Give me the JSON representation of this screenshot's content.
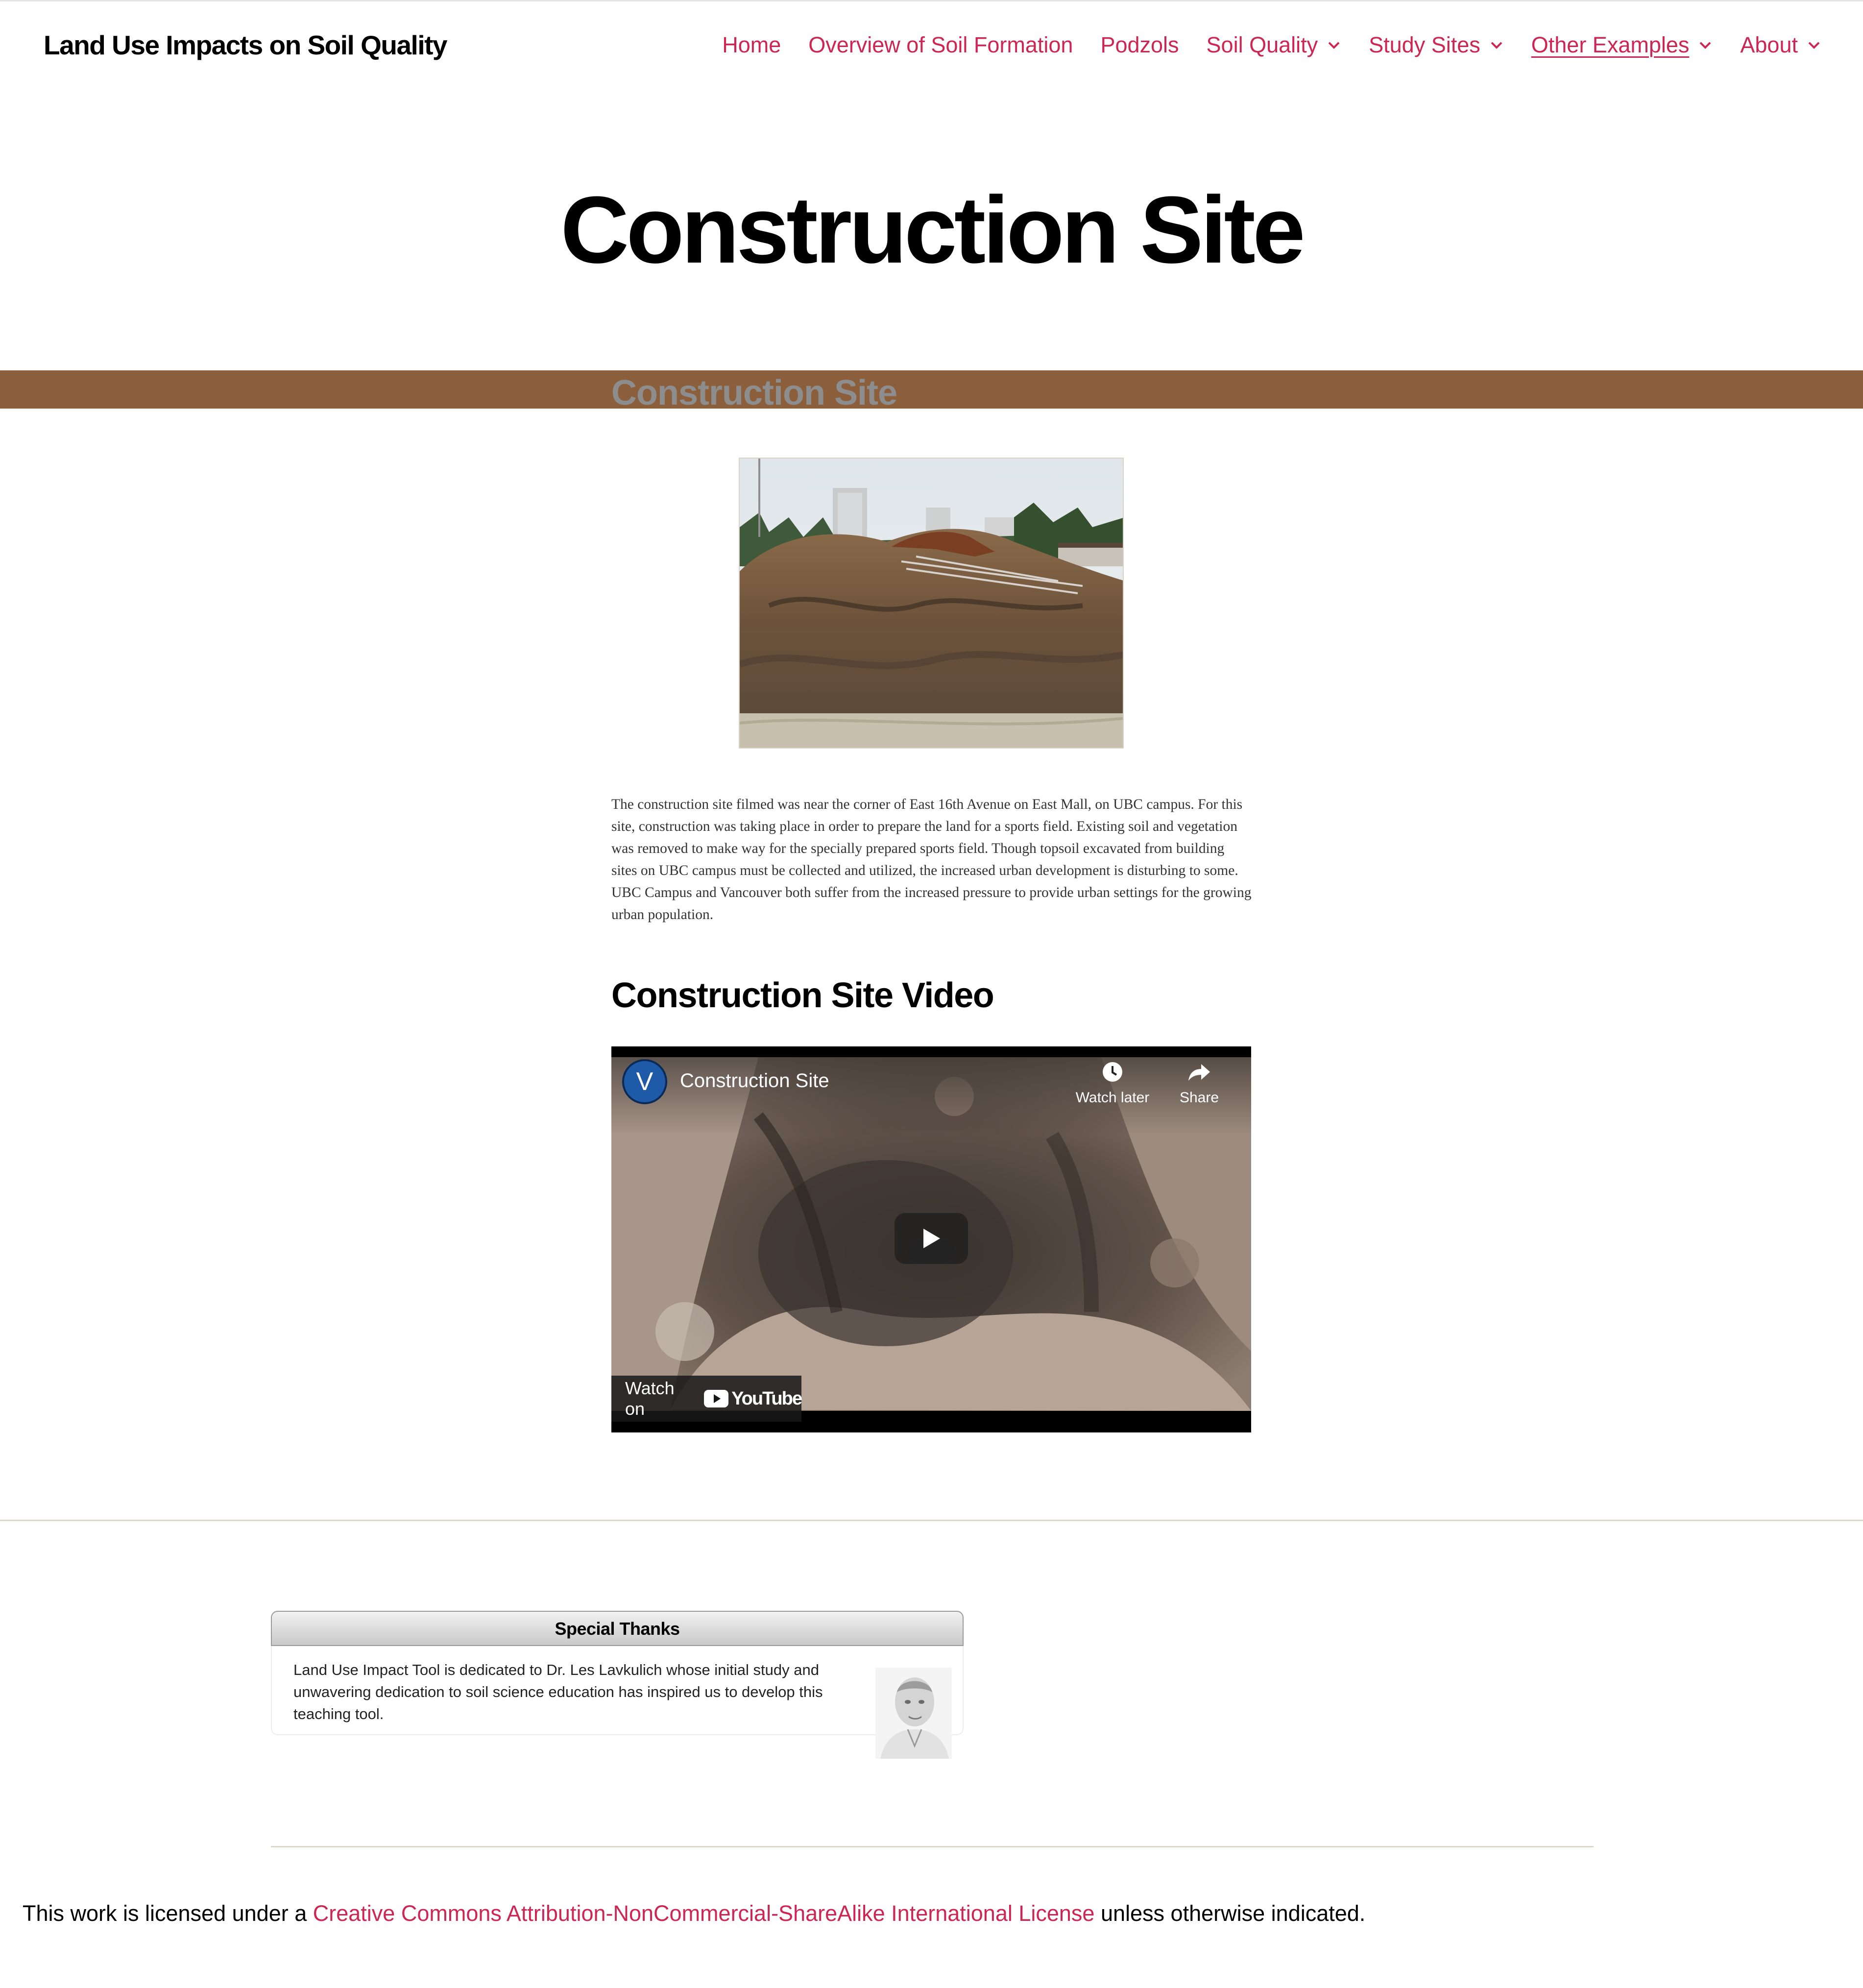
{
  "header": {
    "site_title": "Land Use Impacts on Soil Quality",
    "nav": [
      {
        "label": "Home",
        "has_submenu": false
      },
      {
        "label": "Overview of Soil Formation",
        "has_submenu": false
      },
      {
        "label": "Podzols",
        "has_submenu": false
      },
      {
        "label": "Soil Quality",
        "has_submenu": true
      },
      {
        "label": "Study Sites",
        "has_submenu": true
      },
      {
        "label": "Other Examples",
        "has_submenu": true,
        "current": true
      },
      {
        "label": "About",
        "has_submenu": true
      }
    ]
  },
  "page": {
    "title": "Construction Site",
    "band_title": "Construction Site",
    "body_paragraph": "The construction site filmed was near the corner of East 16th Avenue on East Mall, on UBC campus.  For this site, construction was taking place in order to prepare the land for a sports field.  Existing soil and vegetation was removed to make way for the specially prepared sports field.  Though topsoil excavated from building sites on UBC campus must be collected and utilized, the increased urban development is disturbing to some.  UBC Campus and Vancouver both suffer from the increased pressure to provide urban settings for the growing urban population.",
    "video_heading": "Construction Site Video"
  },
  "video": {
    "channel_initial": "V",
    "title": "Construction Site",
    "watch_later": "Watch later",
    "share": "Share",
    "watch_on": "Watch on",
    "youtube": "YouTube"
  },
  "footer": {
    "thanks_title": "Special Thanks",
    "thanks_text": "Land Use Impact Tool is dedicated to Dr. Les Lavkulich whose initial study and unwavering dedication to soil science education has inspired us to develop this teaching tool.",
    "license_prefix": "This work is licensed under a ",
    "license_link": "Creative Commons Attribution-NonCommercial-ShareAlike International License",
    "license_suffix": " unless otherwise indicated."
  },
  "colors": {
    "accent": "#cd2653",
    "band": "#8b5e3c"
  }
}
